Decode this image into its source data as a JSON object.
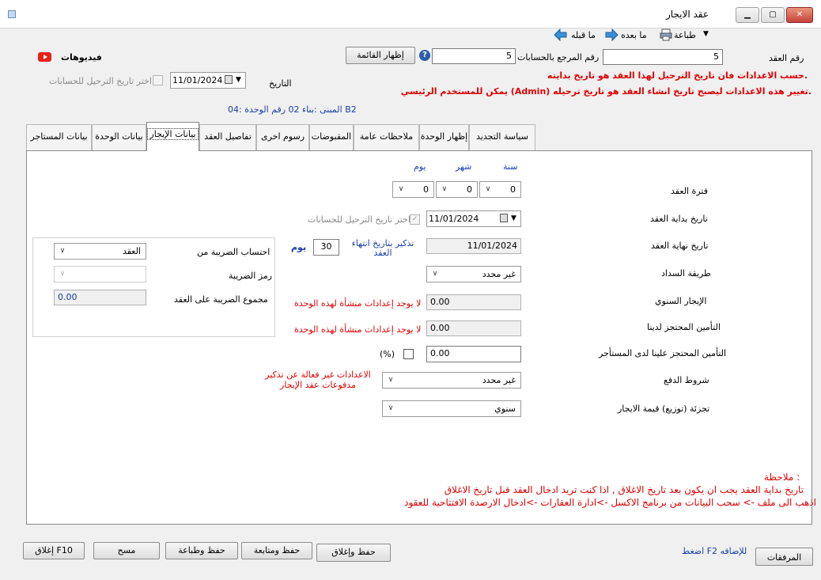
{
  "window": {
    "title": "عقد الايجار"
  },
  "toolbar": {
    "print_label": "طباعة",
    "next_label": "ما بعده",
    "prev_label": "ما قبله"
  },
  "header": {
    "contract_number_label": "رقم العقد",
    "contract_number_value": "5",
    "ref_number_label": "رقم المرجع بالحسابات",
    "ref_number_value": "5",
    "show_list_button": "إظهار القائمة",
    "videos_label": "فيديوهات",
    "date_label": "التاريخ",
    "date_value": "11/01/2024",
    "choose_posting_date_label": "اختر تاريخ الترحيل للحسابات",
    "notice_line_1": "حسب الاعدادات فان تاريخ الترحيل لهذا العقد هو تاريخ بدايته.",
    "notice_line_2": "يمكن للمستخدم الرئيسي (Admin) تغيير هذه الاعدادات ليصبح تاريخ انشاء العقد هو تاريخ ترحيله.",
    "building_info": "المبنى :بناء 02 رقم الوحدة :04 B2"
  },
  "tabs": [
    {
      "label": "سياسة التجديد"
    },
    {
      "label": "إظهار الوحدة"
    },
    {
      "label": "ملاحظات عامة"
    },
    {
      "label": "المقبوضات"
    },
    {
      "label": "رسوم اخرى"
    },
    {
      "label": "تفاصيل العقد"
    },
    {
      "label": "بيانات الإيجار"
    },
    {
      "label": "بيانات الوحدة"
    },
    {
      "label": "بيانات المستاجر"
    }
  ],
  "form": {
    "year_header": "سنة",
    "month_header": "شهر",
    "day_header": "يوم",
    "period_label": "فترة العقد",
    "period_years": "0",
    "period_months": "0",
    "period_days": "0",
    "start_date_label": "تاريخ بداية العقد",
    "start_date_value": "11/01/2024",
    "posting_date_check_label": "اختر تاريخ الترحيل للحسابات",
    "end_date_label": "تاريخ نهاية العقد",
    "end_date_value": "11/01/2024",
    "reminder_label": "تذكير بتاريخ انتهاء العقد",
    "reminder_days_value": "30",
    "reminder_unit": "يوم",
    "payment_method_label": "طريقة السداد",
    "payment_method_value": "غير محدد",
    "annual_rent_label": "الإيجار السنوي",
    "annual_rent_value": "0.00",
    "no_settings_1": "لا يوجد إعدادات منشأة لهذه الوحدة",
    "deposit_with_us_label": "التأمين المحتجز لدينا",
    "deposit_with_us_value": "0.00",
    "no_settings_2": "لا يوجد إعدادات منشأة لهذه الوحدة",
    "deposit_with_tenant_label": "التأمين المحتجز علينا لدى المستأجر",
    "deposit_with_tenant_value": "0.00",
    "percent_label": "(%)",
    "payment_terms_label": "شروط الدفع",
    "payment_terms_value": "غير محدد",
    "reminder_settings_warning": "الاعدادات غير فعالة عن تذكير مدفوعات عقد الإيجار",
    "rent_split_label": "تجزئة (توزيع) قيمة الايجار",
    "rent_split_value": "سنوي",
    "tax_calc_label": "احتساب الضريبة من",
    "tax_calc_value": "العقد",
    "tax_code_label": "رمز الضريبة",
    "tax_code_value": "",
    "tax_total_label": "مجموع الضريبة على العقد",
    "tax_total_value": "0.00",
    "note_title": "ملاحظة :",
    "note_line_1": "تاريخ بداية العقد يجب ان يكون بعد تاريخ الاغلاق , اذا كنت تريد ادخال العقد قبل تاريخ الاغلاق",
    "note_line_2": "اذهب الى ملف -> سحب البيانات من برنامج الاكسل ->ادارة العقارات ->ادخال الارصدة الافتتاحية للعقود"
  },
  "footer": {
    "attachments_button": "المرفقات",
    "f2_hint": "اضغط F2 للإضافه",
    "save_close_button": "حفظ وإغلاق",
    "save_continue_button": "حفظ ومتابعة",
    "save_print_button": "حفظ وطباعة",
    "clear_button": "مسح",
    "close_button": "إغلاق F10"
  },
  "colors": {
    "accent_blue": "#1a3faa",
    "warning_red": "#e00000"
  }
}
